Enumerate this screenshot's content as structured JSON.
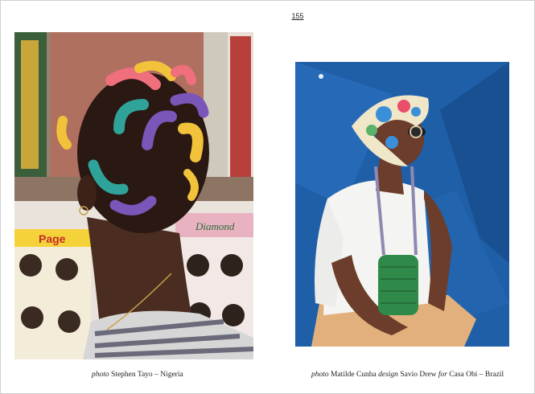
{
  "page": {
    "number": "155"
  },
  "left_photo": {
    "caption": {
      "prefix": "photo",
      "credit": "Stephen Tayo",
      "separator": "–",
      "location": "Nigeria"
    },
    "wall_signs": [
      "Page",
      "Diamond"
    ]
  },
  "right_photo": {
    "caption": {
      "prefix": "photo",
      "photographer": "Matilde Cunha",
      "design_label": "design",
      "designer": "Savio Drew",
      "for_label": "for",
      "brand": "Casa Obi",
      "separator": "–",
      "location": "Brazil"
    }
  }
}
